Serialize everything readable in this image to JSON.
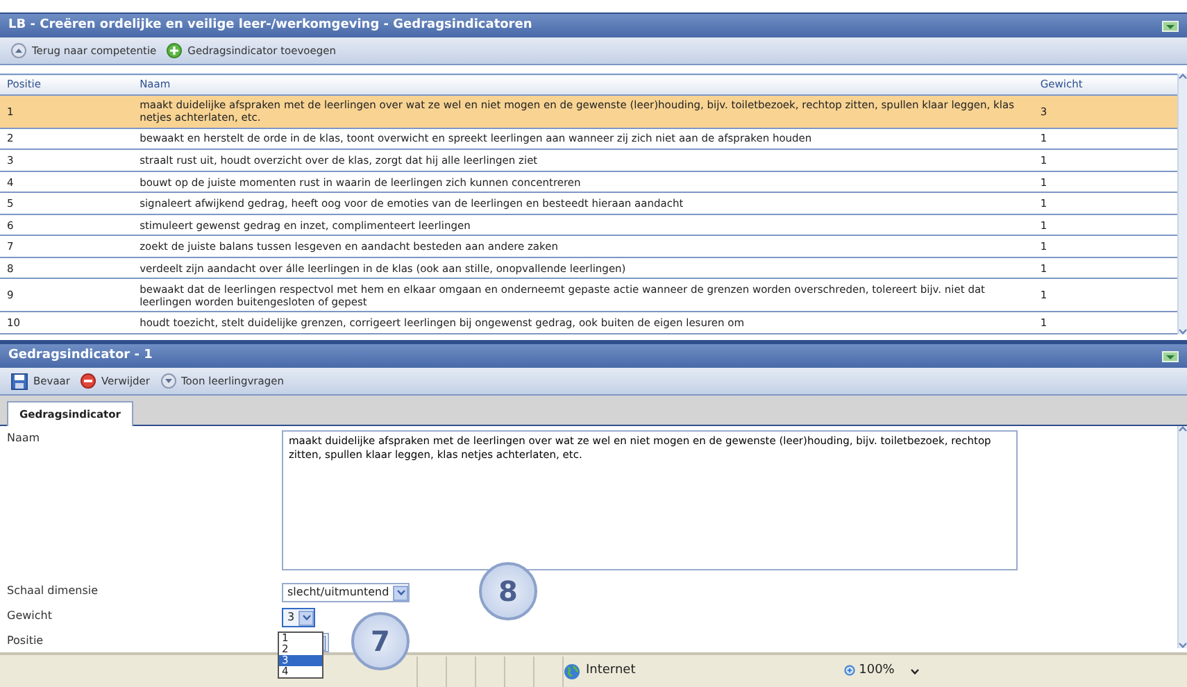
{
  "top_panel": {
    "title": "LB - Creëren ordelijke en veilige leer-/werkomgeving - Gedragsindicatoren",
    "toolbar": [
      {
        "label": "Terug naar competentie"
      },
      {
        "label": "Gedragsindicator toevoegen"
      }
    ],
    "table": {
      "columns": [
        "Positie",
        "Naam",
        "Gewicht"
      ],
      "rows": [
        {
          "positie": "1",
          "naam": "maakt duidelijke afspraken met de leerlingen over wat ze wel en niet mogen en de gewenste (leer)houding, bijv. toiletbezoek, rechtop zitten, spullen klaar leggen, klas netjes achterlaten, etc.",
          "gewicht": "3",
          "selected": true
        },
        {
          "positie": "2",
          "naam": "bewaakt en herstelt de orde in de klas, toont overwicht en spreekt leerlingen aan wanneer zij zich niet aan de afspraken houden",
          "gewicht": "1",
          "selected": false
        },
        {
          "positie": "3",
          "naam": "straalt rust uit, houdt overzicht over de klas, zorgt dat hij alle leerlingen ziet",
          "gewicht": "1",
          "selected": false
        },
        {
          "positie": "4",
          "naam": "bouwt op de juiste momenten rust in waarin de leerlingen zich kunnen concentreren",
          "gewicht": "1",
          "selected": false
        },
        {
          "positie": "5",
          "naam": "signaleert afwijkend gedrag, heeft oog voor de emoties van de leerlingen en besteedt hieraan aandacht",
          "gewicht": "1",
          "selected": false
        },
        {
          "positie": "6",
          "naam": "stimuleert gewenst gedrag en inzet, complimenteert leerlingen",
          "gewicht": "1",
          "selected": false
        },
        {
          "positie": "7",
          "naam": "zoekt de juiste balans tussen lesgeven en aandacht besteden aan andere zaken",
          "gewicht": "1",
          "selected": false
        },
        {
          "positie": "8",
          "naam": "verdeelt zijn aandacht over álle leerlingen in de klas (ook aan stille, onopvallende leerlingen)",
          "gewicht": "1",
          "selected": false
        },
        {
          "positie": "9",
          "naam": "bewaakt dat de leerlingen respectvol met hem en elkaar omgaan en onderneemt gepaste actie wanneer de grenzen worden overschreden, tolereert bijv. niet dat leerlingen worden buitengesloten of gepest",
          "gewicht": "1",
          "selected": false
        },
        {
          "positie": "10",
          "naam": "houdt toezicht, stelt duidelijke grenzen, corrigeert leerlingen bij ongewenst gedrag, ook buiten de eigen lesuren om",
          "gewicht": "1",
          "selected": false
        }
      ]
    }
  },
  "detail_panel": {
    "title": "Gedragsindicator - 1",
    "toolbar": [
      {
        "label": "Bevaar"
      },
      {
        "label": "Verwijder"
      },
      {
        "label": "Toon leerlingvragen"
      }
    ],
    "tabs": [
      {
        "label": "Gedragsindicator",
        "selected": true
      }
    ],
    "fields": [
      {
        "label": "Naam",
        "kind": "textarea",
        "value": "maakt duidelijke afspraken met de leerlingen over wat ze wel en niet mogen en de gewenste (leer)houding, bijv. toiletbezoek, rechtop zitten, spullen klaar leggen, klas netjes achterlaten, etc."
      },
      {
        "label": "Schaal dimensie",
        "kind": "select",
        "value": "slecht/uitmuntend",
        "expanded": false
      },
      {
        "label": "Gewicht",
        "kind": "select",
        "value": "3",
        "expanded": true,
        "options": [
          {
            "label": "1",
            "selected": false
          },
          {
            "label": "2",
            "selected": false
          },
          {
            "label": "3",
            "selected": true
          },
          {
            "label": "4",
            "selected": false
          }
        ]
      },
      {
        "label": "Positie",
        "kind": "select",
        "expanded": false
      }
    ]
  },
  "annotations": [
    {
      "label": "8"
    },
    {
      "label": "7"
    }
  ],
  "status_bar": {
    "zone": "Internet",
    "zoom": "100%"
  }
}
